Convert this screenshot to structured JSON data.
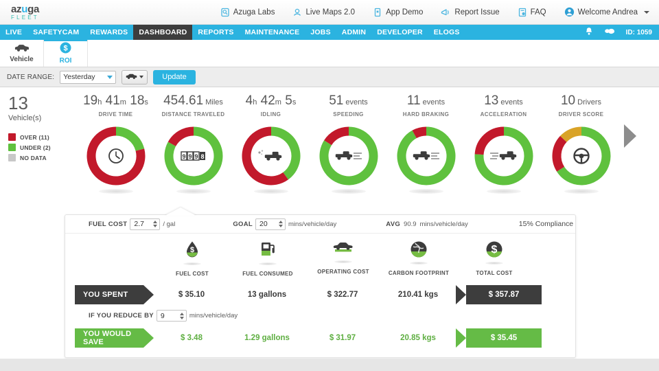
{
  "brand": {
    "name_part1": "az",
    "name_u": "u",
    "name_part2": "ga",
    "sub": "FLEET"
  },
  "topbar": {
    "links": [
      {
        "label": "Azuga Labs",
        "icon": "lab-flask-icon"
      },
      {
        "label": "Live Maps 2.0",
        "icon": "map-pin-icon"
      },
      {
        "label": "App Demo",
        "icon": "mobile-app-icon"
      },
      {
        "label": "Report Issue",
        "icon": "megaphone-icon"
      },
      {
        "label": "FAQ",
        "icon": "faq-document-icon"
      },
      {
        "label": "Welcome Andrea",
        "icon": "user-avatar-icon"
      }
    ]
  },
  "nav": {
    "items": [
      {
        "label": "LIVE",
        "active": false
      },
      {
        "label": "SAFETYCAM",
        "active": false
      },
      {
        "label": "REWARDS",
        "active": false
      },
      {
        "label": "DASHBOARD",
        "active": true
      },
      {
        "label": "REPORTS",
        "active": false
      },
      {
        "label": "MAINTENANCE",
        "active": false
      },
      {
        "label": "JOBS",
        "active": false
      },
      {
        "label": "ADMIN",
        "active": false
      },
      {
        "label": "DEVELOPER",
        "active": false
      },
      {
        "label": "ELOGS",
        "active": false
      }
    ],
    "id_label": "ID: 1059"
  },
  "subtabs": [
    {
      "label": "Vehicle",
      "icon": "truck-icon",
      "active": false
    },
    {
      "label": "ROI",
      "icon": "dollar-coin-icon",
      "active": true
    }
  ],
  "filterbar": {
    "date_range_label": "DATE RANGE:",
    "date_range_value": "Yesterday",
    "vehicle_filter_icon": "car-filter-icon",
    "update_label": "Update"
  },
  "vehicles": {
    "count": "13",
    "label": "Vehicle(s)",
    "legend": [
      {
        "label": "OVER (11)",
        "color": "#c2192b"
      },
      {
        "label": "UNDER (2)",
        "color": "#5fc13e"
      },
      {
        "label": "NO DATA",
        "color": "#c8c8c8"
      }
    ]
  },
  "chart_data": {
    "type": "pie",
    "title": "Fleet KPI donut gauges",
    "legend": [
      "OVER",
      "UNDER",
      "NO DATA"
    ],
    "colors": {
      "over": "#c2192b",
      "under": "#5fc13e",
      "partial": "#d9a327",
      "nodata": "#c8c8c8"
    },
    "kpis": [
      {
        "label": "DRIVE TIME",
        "icon": "speedometer-icon",
        "value_parts": [
          {
            "t": "19",
            "c": "big"
          },
          {
            "t": "h",
            "c": "sm"
          },
          {
            "t": " 41",
            "c": "big"
          },
          {
            "t": "m",
            "c": "sm"
          },
          {
            "t": " 18",
            "c": "big"
          },
          {
            "t": "s",
            "c": "sm"
          }
        ],
        "segments": [
          {
            "name": "UNDER",
            "pct": 21,
            "color": "#5fc13e"
          },
          {
            "name": "OVER",
            "pct": 79,
            "color": "#c2192b"
          }
        ]
      },
      {
        "label": "DISTANCE TRAVELED",
        "icon": "odometer-icon",
        "value_parts": [
          {
            "t": "454.61",
            "c": "big"
          },
          {
            "t": " Miles",
            "c": "sm"
          }
        ],
        "segments": [
          {
            "name": "UNDER",
            "pct": 83,
            "color": "#5fc13e"
          },
          {
            "name": "OVER",
            "pct": 17,
            "color": "#c2192b"
          }
        ]
      },
      {
        "label": "IDLING",
        "icon": "idling-truck-icon",
        "value_parts": [
          {
            "t": "4",
            "c": "big"
          },
          {
            "t": "h",
            "c": "sm"
          },
          {
            "t": " 42",
            "c": "big"
          },
          {
            "t": "m",
            "c": "sm"
          },
          {
            "t": " 5",
            "c": "big"
          },
          {
            "t": "s",
            "c": "sm"
          }
        ],
        "segments": [
          {
            "name": "UNDER",
            "pct": 40,
            "color": "#5fc13e"
          },
          {
            "name": "OVER",
            "pct": 60,
            "color": "#c2192b"
          }
        ]
      },
      {
        "label": "SPEEDING",
        "icon": "speeding-truck-icon",
        "value_parts": [
          {
            "t": "51",
            "c": "big"
          },
          {
            "t": " events",
            "c": "sm"
          }
        ],
        "segments": [
          {
            "name": "UNDER",
            "pct": 84,
            "color": "#5fc13e"
          },
          {
            "name": "OVER",
            "pct": 16,
            "color": "#c2192b"
          }
        ]
      },
      {
        "label": "HARD BRAKING",
        "icon": "braking-truck-icon",
        "value_parts": [
          {
            "t": "11",
            "c": "big"
          },
          {
            "t": " events",
            "c": "sm"
          }
        ],
        "segments": [
          {
            "name": "UNDER",
            "pct": 92,
            "color": "#5fc13e"
          },
          {
            "name": "OVER",
            "pct": 8,
            "color": "#c2192b"
          }
        ]
      },
      {
        "label": "ACCELERATION",
        "icon": "accelerating-truck-icon",
        "value_parts": [
          {
            "t": "13",
            "c": "big"
          },
          {
            "t": " events",
            "c": "sm"
          }
        ],
        "segments": [
          {
            "name": "UNDER",
            "pct": 76,
            "color": "#5fc13e"
          },
          {
            "name": "OVER",
            "pct": 24,
            "color": "#c2192b"
          }
        ]
      },
      {
        "label": "DRIVER SCORE",
        "icon": "steering-wheel-icon",
        "value_parts": [
          {
            "t": "10",
            "c": "big"
          },
          {
            "t": " Drivers",
            "c": "sm"
          }
        ],
        "segments": [
          {
            "name": "UNDER",
            "pct": 66,
            "color": "#5fc13e"
          },
          {
            "name": "OVER",
            "pct": 21,
            "color": "#c2192b"
          },
          {
            "name": "PARTIAL",
            "pct": 13,
            "color": "#d9a327"
          }
        ]
      }
    ]
  },
  "roi": {
    "fuel_cost_label": "FUEL COST",
    "fuel_cost_value": "2.7",
    "fuel_cost_unit": "/ gal",
    "goal_label": "GOAL",
    "goal_value": "20",
    "goal_unit": "mins/vehicle/day",
    "avg_label": "AVG",
    "avg_value": "90.9",
    "avg_unit": "mins/vehicle/day",
    "compliance": "15% Compliance",
    "columns": [
      {
        "label": "FUEL COST",
        "icon": "fuel-drop-icon"
      },
      {
        "label": "FUEL CONSUMED",
        "icon": "fuel-pump-icon"
      },
      {
        "label": "OPERATING COST",
        "icon": "car-icon"
      },
      {
        "label": "CARBON FOOTPRINT",
        "icon": "globe-icon"
      },
      {
        "label": "TOTAL COST",
        "icon": "dollar-coin-icon"
      }
    ],
    "spent": {
      "label": "YOU SPENT",
      "cells": [
        "$ 35.10",
        "13 gallons",
        "$ 322.77",
        "210.41 kgs"
      ],
      "total": "$ 357.87"
    },
    "reduce_label": "IF YOU REDUCE BY",
    "reduce_value": "9",
    "reduce_unit": "mins/vehicle/day",
    "save": {
      "label": "YOU WOULD SAVE",
      "cells": [
        "$ 3.48",
        "1.29 gallons",
        "$ 31.97",
        "20.85 kgs"
      ],
      "total": "$ 35.45"
    }
  }
}
